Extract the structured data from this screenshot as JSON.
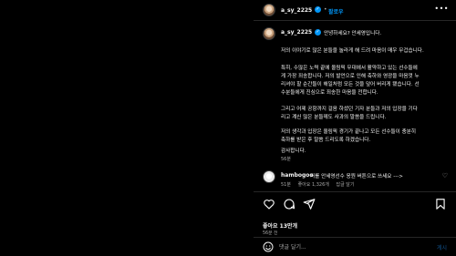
{
  "header": {
    "username": "a_sy_2225",
    "verified_mark": "✓",
    "separator": "•",
    "follow_label": "팔로우",
    "more_icon": "more-horizontal-icon"
  },
  "caption": {
    "username": "a_sy_2225",
    "verified_mark": "✓",
    "lines": [
      "안녕하세요? 안세영입니다.",
      "저의 이야기로 많은 분들을 놀라게 해 드려 마음이 매우 무겁습니다.",
      "특히, 수많은 노력 끝에 올림픽 무대에서 활약하고 있는 선수들에",
      "게 가장 죄송합니다. 저의 발언으로 인해 축하와 영광을 마음껏 누",
      "리셔야 할 순간들이 해일처럼 모든 것을 덮어 버리게 됐습니다. 선",
      "수분들에게 진심으로 죄송한 마음을 전합니다.",
      "그리고 어제 공항까지 걸음 하셨던 기자 분들과 저의 입장을 기다",
      "리고 계신 많은 분들께도 사과의 말씀을 드립니다.",
      "저의 생각과 입장은 올림픽 경기가 끝나고 모든 선수들이 충분히",
      "축하를 받은 후 말씀 드리도록 하겠습니다.",
      "감사합니다."
    ],
    "time": "56분"
  },
  "comment": {
    "username": "hambogoo",
    "text": "저를 안세영선수 응원 버튼으로 쓰세요 --->",
    "time": "51분",
    "likes": "좋아요 1,326개",
    "reply": "답글 달기"
  },
  "actions": {
    "likes": "좋아요 13만개",
    "date": "56분 전"
  },
  "add_comment": {
    "placeholder": "댓글 달기...",
    "post_label": "게시"
  },
  "colors": {
    "background": "#000000",
    "accent": "#0095f6",
    "muted": "#a8a8a8",
    "divider": "#262626"
  }
}
